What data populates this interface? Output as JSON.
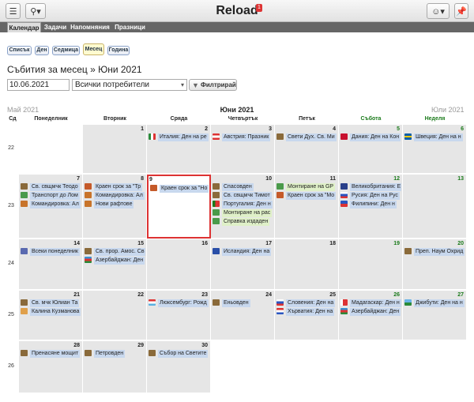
{
  "app": {
    "title": "Reload",
    "notifications": "1"
  },
  "nav": [
    "Календар",
    "Задачи",
    "Напомняния",
    "Празници"
  ],
  "views": [
    "Списък",
    "Ден",
    "Седмица",
    "Месец",
    "Година"
  ],
  "page_title": "Събития за месец » Юни 2021",
  "filter": {
    "date": "10.06.2021",
    "user": "Всички потребители",
    "button": "Филтрирай"
  },
  "month_nav": {
    "prev": "Май 2021",
    "current": "Юни 2021",
    "next": "Юли 2021"
  },
  "week_label": "Сд",
  "weekdays": [
    "Понеделник",
    "Вторник",
    "Сряда",
    "Четвъртък",
    "Петък",
    "Събота",
    "Неделя"
  ],
  "weeks": [
    {
      "num": "22",
      "days": [
        {
          "d": "",
          "e": []
        },
        {
          "d": "1",
          "e": []
        },
        {
          "d": "2",
          "e": [
            {
              "t": "Италия: Ден на ре",
              "i": "flag-italy"
            }
          ]
        },
        {
          "d": "3",
          "e": [
            {
              "t": "Австрия: Празник",
              "i": "flag-austria"
            }
          ]
        },
        {
          "d": "4",
          "e": [
            {
              "t": "Свети Дух. Св. Ми",
              "i": "church-icon"
            }
          ]
        },
        {
          "d": "5",
          "e": [
            {
              "t": "Дания: Ден на Кон",
              "i": "flag-denmark"
            }
          ]
        },
        {
          "d": "6",
          "e": [
            {
              "t": "Швеция: Ден на н",
              "i": "flag-sweden"
            }
          ]
        }
      ]
    },
    {
      "num": "23",
      "days": [
        {
          "d": "7",
          "e": [
            {
              "t": "Св. свщмчк Теодо",
              "i": "church-icon"
            },
            {
              "t": "Транспорт до Лом",
              "i": "check-icon"
            },
            {
              "t": "Командировка: Ал",
              "i": "bag-icon"
            }
          ]
        },
        {
          "d": "8",
          "e": [
            {
              "t": "Краен срок за \"Тр",
              "i": "calendar-icon"
            },
            {
              "t": "Командировка: Ал",
              "i": "bag-icon"
            },
            {
              "t": "Нови рафтове",
              "i": "bag-icon"
            }
          ]
        },
        {
          "d": "9",
          "e": [
            {
              "t": "Краен срок за \"Но",
              "i": "calendar-icon"
            }
          ]
        },
        {
          "d": "10",
          "e": [
            {
              "t": "Спасовден",
              "i": "church-icon"
            },
            {
              "t": "Св. свщмчк Тимот",
              "i": "church-icon"
            },
            {
              "t": "Португалия: Ден н",
              "i": "flag-portugal"
            },
            {
              "t": "Монтиране на рас",
              "i": "check-icon",
              "c": "green"
            },
            {
              "t": "Справка издаден",
              "i": "check-icon",
              "c": "green"
            }
          ]
        },
        {
          "d": "11",
          "e": [
            {
              "t": "Монтиране на GP",
              "i": "check-icon",
              "c": "green"
            },
            {
              "t": "Краен срок за \"Мо",
              "i": "calendar-icon"
            }
          ]
        },
        {
          "d": "12",
          "e": [
            {
              "t": "Великобритания: Е",
              "i": "flag-uk"
            },
            {
              "t": "Русия: Ден на Рус",
              "i": "flag-russia"
            },
            {
              "t": "Филипини: Ден н",
              "i": "flag-philippines"
            }
          ]
        },
        {
          "d": "13",
          "e": []
        }
      ]
    },
    {
      "num": "24",
      "days": [
        {
          "d": "14",
          "e": [
            {
              "t": "Всеки понеделник",
              "i": "repeat-icon"
            }
          ]
        },
        {
          "d": "15",
          "e": [
            {
              "t": "Св. прор. Амос. Св",
              "i": "church-icon"
            },
            {
              "t": "Азербайджан: Ден",
              "i": "flag-azerbaijan"
            }
          ]
        },
        {
          "d": "16",
          "e": []
        },
        {
          "d": "17",
          "e": [
            {
              "t": "Исландия: Ден на",
              "i": "flag-iceland"
            }
          ]
        },
        {
          "d": "18",
          "e": []
        },
        {
          "d": "19",
          "e": []
        },
        {
          "d": "20",
          "e": [
            {
              "t": "Преп. Наум Охрид",
              "i": "church-icon"
            }
          ]
        }
      ]
    },
    {
      "num": "25",
      "days": [
        {
          "d": "21",
          "e": [
            {
              "t": "Св. мчк Юлиан Та",
              "i": "church-icon"
            },
            {
              "t": "Калина Кузманова",
              "i": "cake-icon"
            }
          ]
        },
        {
          "d": "22",
          "e": []
        },
        {
          "d": "23",
          "e": [
            {
              "t": "Люксембург: Рожд",
              "i": "flag-luxembourg"
            }
          ]
        },
        {
          "d": "24",
          "e": [
            {
              "t": "Еньовден",
              "i": "church-icon"
            }
          ]
        },
        {
          "d": "25",
          "e": [
            {
              "t": "Словения: Ден на",
              "i": "flag-slovenia"
            },
            {
              "t": "Хърватия: Ден на",
              "i": "flag-croatia"
            }
          ]
        },
        {
          "d": "26",
          "e": [
            {
              "t": "Мадагаскар: Ден н",
              "i": "flag-madagascar"
            },
            {
              "t": "Азербайджан: Ден",
              "i": "flag-azerbaijan"
            }
          ]
        },
        {
          "d": "27",
          "e": [
            {
              "t": "Джибути: Ден на н",
              "i": "flag-djibouti"
            }
          ]
        }
      ]
    },
    {
      "num": "26",
      "days": [
        {
          "d": "28",
          "e": [
            {
              "t": "Пренасяне мощит",
              "i": "church-icon"
            }
          ]
        },
        {
          "d": "29",
          "e": [
            {
              "t": "Петровден",
              "i": "church-icon"
            }
          ]
        },
        {
          "d": "30",
          "e": [
            {
              "t": "Събор на Светите",
              "i": "church-icon"
            }
          ]
        },
        {
          "d": "",
          "e": []
        },
        {
          "d": "",
          "e": []
        },
        {
          "d": "",
          "e": []
        },
        {
          "d": "",
          "e": []
        }
      ]
    }
  ]
}
